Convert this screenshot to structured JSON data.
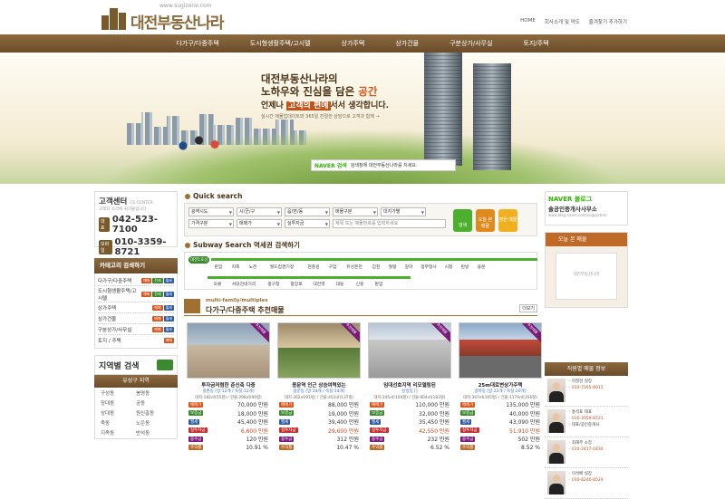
{
  "logo": {
    "url": "www.sugizone.com",
    "name": "대전부동산나라"
  },
  "toplinks": [
    "HOME",
    "회사소개 및 약도",
    "즐겨찾기 추가하기"
  ],
  "nav": [
    "다가구/다중주택",
    "도시형생활주택/고시텔",
    "상가주택",
    "상가건물",
    "구분상가/사무실",
    "토지/주택"
  ],
  "hero": {
    "line1a": "대전부동산나라의",
    "line1b": "노하우와 진심을 담은 ",
    "line1c": "공간",
    "line2a": "언제나 ",
    "line2b": "고객의 편에",
    "line2c": "서서 생각합니다.",
    "line3": "실시간 매물업데이트와 365일 친절한 상담으로 고객과 함께 →",
    "naver_logo": "NAVER 검색",
    "naver_text": "검색창에 대전부동산나라를 치세요."
  },
  "cs": {
    "title": "고객센터",
    "en": "CS CENTER",
    "sub": "고객의 소리에 귀기울입니다",
    "tel_tag": "대표",
    "tel": "042-523-7100",
    "mob_tag": "모바일",
    "mob": "010-3359-8721"
  },
  "category": {
    "title": "카테고리 검색하기",
    "items": [
      "다가구/다중주택",
      "도시형생활주택/고시텔",
      "상가주택",
      "상가건물",
      "구분상가/사무실",
      "토지 / 주택"
    ],
    "badges": [
      "매매",
      "전세",
      "월세"
    ]
  },
  "area": {
    "title": "지역별 검색",
    "head": "유성구 지역",
    "items": [
      "구성동",
      "봉명동",
      "장대동",
      "궁동",
      "상대동",
      "원신흥동",
      "죽동",
      "노은동",
      "지족동",
      "반석동"
    ]
  },
  "quick": {
    "title": "Quick search",
    "selects": [
      "광역시도",
      "시/군/구",
      "읍/면/동",
      "매물구분",
      "대지가별",
      "가격구분",
      "매매가",
      "실투자금"
    ],
    "keyword": "제목 또는 매물번호를 입력하세요",
    "btn_search": "검색",
    "btn_today": "오늘 본 매물",
    "btn_recent": "찜한 매물"
  },
  "subway": {
    "title": "Subway Search 역세권 검색하기",
    "line_label": "대전1호선",
    "row1": [
      "판암",
      "지족",
      "노은",
      "월드컵경기장",
      "현충원",
      "구암",
      "유성온천",
      "갑천",
      "월평",
      "갈마",
      "정부청사",
      "시청",
      "탄방",
      "용문"
    ],
    "row2": [
      "오룡",
      "서대전네거리",
      "중구청",
      "중앙로",
      "대전역",
      "대동",
      "신흥",
      "판암"
    ]
  },
  "listing": {
    "en": "multi-family/multiplex",
    "title": "다가구/다중주택 추천매물",
    "more": "더보기"
  },
  "labels": [
    "매매가",
    "보증금",
    "월세",
    "실투자금",
    "융수금",
    "수익률"
  ],
  "cards": [
    {
      "title": "투자금저렴한 준신축 다중",
      "sub": "송촌동 [방:12개 / 욕실:12개]",
      "addr": "대지:182㎡(55평) / 건물:298㎡(90평)",
      "vals": [
        "70,000 만원",
        "18,000 만원",
        "45,400 만원",
        "6,600 만원",
        "120 만원",
        "10.91 %"
      ],
      "ribbon": "추천매물"
    },
    {
      "title": "용문역 인근 상승여력있는",
      "sub": "용문동 [방:14개 / 욕실:14개]",
      "addr": "대지:302㎡(91평) / 건물:452㎡(137평)",
      "vals": [
        "88,000 만원",
        "19,000 만원",
        "39,400 만원",
        "29,600 만원",
        "312 만원",
        "10.47 %"
      ],
      "ribbon": "추천매물"
    },
    {
      "title": "임대선호지역 리모델링된",
      "sub": "탄방동 []",
      "addr": "대지:345㎡(104평) / 건물:604㎡(183평)",
      "vals": [
        "110,000 만원",
        "32,000 만원",
        "35,450 만원",
        "42,550 만원",
        "232 만원",
        "6.52 %"
      ],
      "ribbon": "추천매물"
    },
    {
      "title": "25m대로변상가주택",
      "sub": "갈마동 [방:22개 / 욕실:20개]",
      "addr": "대지:347㎡(105평) / 건물:1179㎡(356평)",
      "vals": [
        "135,000 만원",
        "40,000 만원",
        "43,090 만원",
        "51,910 만원",
        "502 만원",
        "8.52 %"
      ],
      "ribbon": "추천매물"
    }
  ],
  "naver_blog": {
    "title": "NAVER 블로그",
    "name": "솔공인중개사사무소",
    "url": "www.blog.naver.com/sngsystem"
  },
  "today": {
    "title": "오늘 본 매물",
    "img": "대전부동산나라"
  },
  "staff": {
    "title": "직원별 매물 정보",
    "people": [
      {
        "name": "· 이필현 실장",
        "phone": "· 010-7165-8015",
        "extra": ""
      },
      {
        "name": "· 홍석표 대표",
        "phone": "· 010-3359-8721",
        "extra": "· 대표/공인중개사"
      },
      {
        "name": "· 최해주 소장",
        "phone": "· 010-2417-1836",
        "extra": ""
      },
      {
        "name": "· 이석배 실장",
        "phone": "· 010-8246-8529",
        "extra": ""
      }
    ]
  },
  "colors": {
    "brown": "#7a5a2a",
    "orange": "#d9561e",
    "green": "#4caf2e",
    "purple": "#7a1b7a"
  }
}
